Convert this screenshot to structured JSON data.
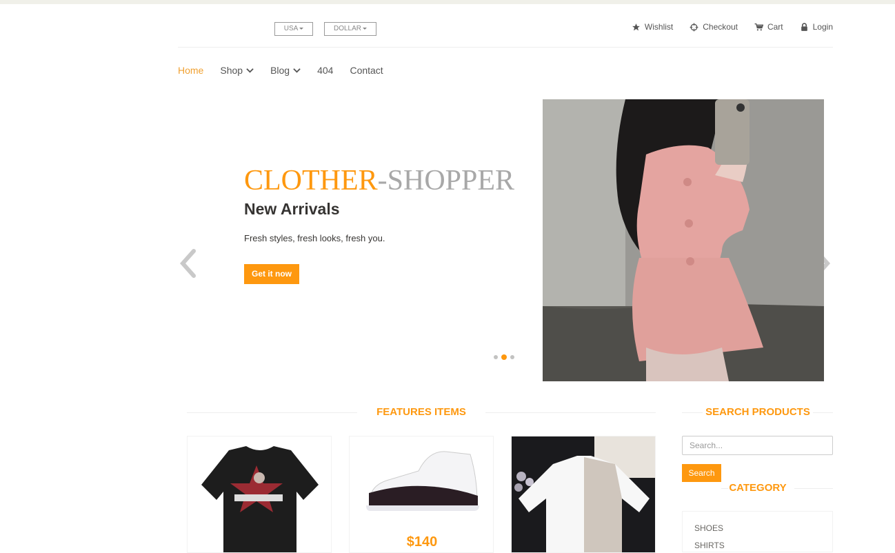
{
  "header": {
    "country_label": "USA",
    "currency_label": "DOLLAR",
    "account_links": [
      {
        "label": "Wishlist",
        "icon": "star-icon"
      },
      {
        "label": "Checkout",
        "icon": "crosshairs-icon"
      },
      {
        "label": "Cart",
        "icon": "shopping-cart-icon"
      },
      {
        "label": "Login",
        "icon": "lock-icon"
      }
    ]
  },
  "nav": {
    "items": [
      {
        "label": "Home",
        "active": true
      },
      {
        "label": "Shop",
        "dropdown": true
      },
      {
        "label": "Blog",
        "dropdown": true
      },
      {
        "label": "404"
      },
      {
        "label": "Contact"
      }
    ]
  },
  "hero": {
    "title_part1": "CLOTHER",
    "title_part2": "-SHOPPER",
    "subtitle": "New Arrivals",
    "text": "Fresh styles, fresh looks, fresh you.",
    "button_label": "Get it now",
    "slide_count": 3,
    "active_slide": 2
  },
  "features": {
    "title": "FEATURES ITEMS",
    "items": [
      {
        "price": "",
        "image": "black graphic t-shirt"
      },
      {
        "price": "$140",
        "image": "white and black sneaker"
      },
      {
        "price": "",
        "image": "white satin shirt"
      }
    ]
  },
  "sidebar": {
    "search_title": "SEARCH PRODUCTS",
    "search_placeholder": "Search...",
    "search_button": "Search",
    "category_title": "CATEGORY",
    "categories": [
      "SHOES",
      "SHIRTS"
    ]
  },
  "colors": {
    "accent": "#fe980f",
    "topstrip": "#f0f0e9"
  }
}
